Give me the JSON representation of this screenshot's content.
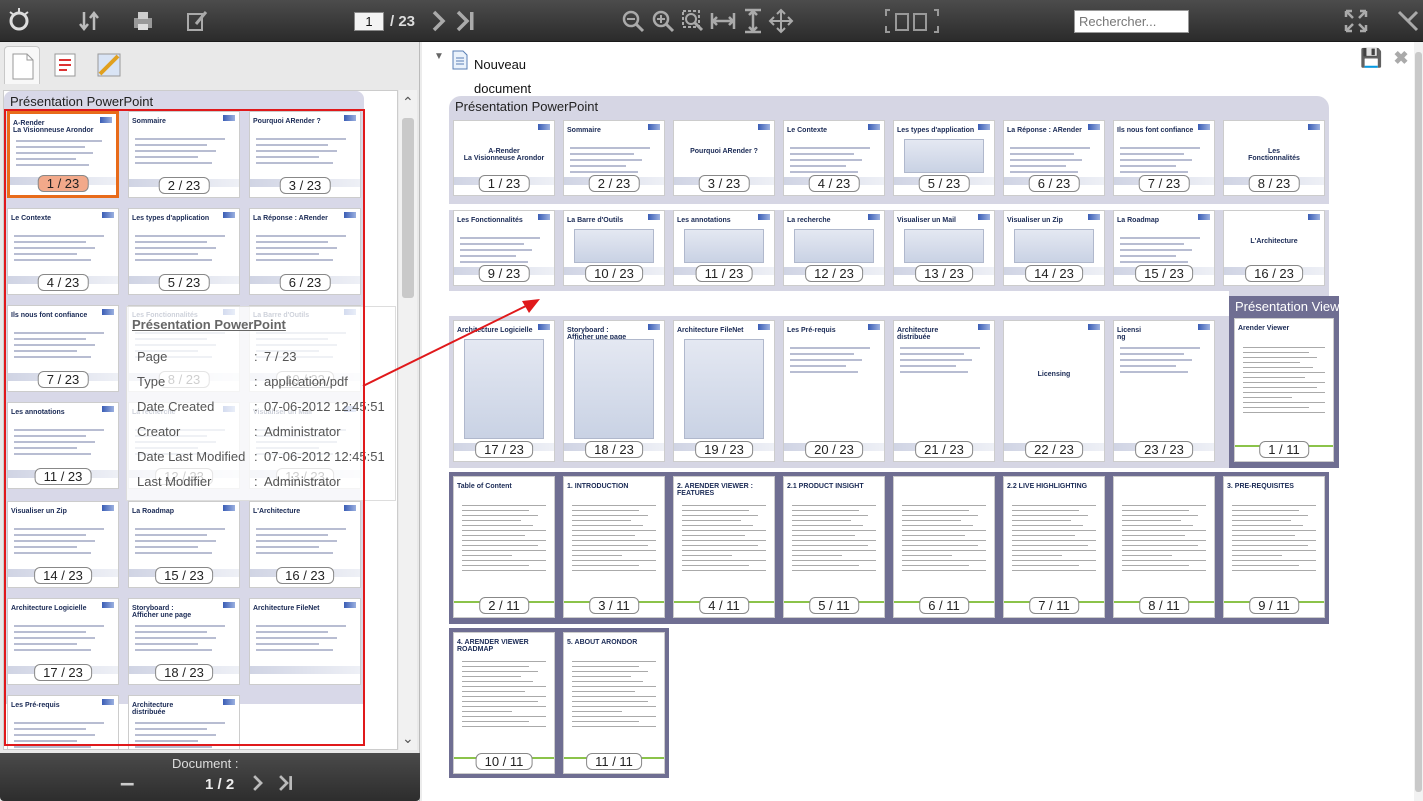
{
  "toolbar": {
    "current_page": "1",
    "total_pages": "/ 23",
    "search_placeholder": "Rechercher..."
  },
  "left_panel": {
    "group_title": "Présentation PowerPoint",
    "thumbnails": [
      {
        "label": "1 / 23",
        "title": "A-Render\nLa Visionneuse Arondor",
        "selected": true
      },
      {
        "label": "2 / 23",
        "title": "Sommaire"
      },
      {
        "label": "3 / 23",
        "title": "Pourquoi ARender ?"
      },
      {
        "label": "4 / 23",
        "title": "Le Contexte"
      },
      {
        "label": "5 / 23",
        "title": "Les types d'application"
      },
      {
        "label": "6 / 23",
        "title": "La Réponse : ARender"
      },
      {
        "label": "7 / 23",
        "title": "Ils nous font confiance"
      },
      {
        "label": "8 / 23",
        "title": "Les Fonctionnalités"
      },
      {
        "label": "10 / 23",
        "title": "La Barre d'Outils"
      },
      {
        "label": "11 / 23",
        "title": "Les annotations"
      },
      {
        "label": "12 / 23",
        "title": "La recherche"
      },
      {
        "label": "13 / 23",
        "title": "Visualiser un Mail"
      },
      {
        "label": "14 / 23",
        "title": "Visualiser un Zip"
      },
      {
        "label": "15 / 23",
        "title": "La Roadmap"
      },
      {
        "label": "16 / 23",
        "title": "L'Architecture"
      },
      {
        "label": "17 / 23",
        "title": "Architecture Logicielle"
      },
      {
        "label": "18 / 23",
        "title": "Storyboard :\nAfficher une page"
      },
      {
        "label": "",
        "title": "Architecture FileNet"
      },
      {
        "label": "",
        "title": "Les Pré-requis"
      },
      {
        "label": "",
        "title": "Architecture\ndistribuée"
      }
    ],
    "tooltip": {
      "title": "Présentation PowerPoint",
      "rows": [
        {
          "key": "Page",
          "value": "7 / 23"
        },
        {
          "key": "Type",
          "value": "application/pdf"
        },
        {
          "key": "Date Created",
          "value": "07-06-2012 12:45:51"
        },
        {
          "key": "Creator",
          "value": "Administrator"
        },
        {
          "key": "Date Last Modified",
          "value": "07-06-2012 12:45:51"
        },
        {
          "key": "Last Modifier",
          "value": "Administrator"
        }
      ]
    },
    "bottom_nav": {
      "label": "Document :",
      "page": "1 / 2"
    }
  },
  "right_panel": {
    "document_title": "Nouveau document",
    "group1_title": "Présentation PowerPoint",
    "group2_title": "Présentation Viewer",
    "row1": [
      {
        "label": "1 / 23",
        "title": "A-Render\nLa Visionneuse Arondor",
        "center": true
      },
      {
        "label": "2 / 23",
        "title": "Sommaire"
      },
      {
        "label": "3 / 23",
        "title": "Pourquoi ARender ?",
        "center": true
      },
      {
        "label": "4 / 23",
        "title": "Le Contexte"
      },
      {
        "label": "5 / 23",
        "title": "Les types d'application",
        "pic": true
      },
      {
        "label": "6 / 23",
        "title": "La Réponse : ARender"
      },
      {
        "label": "7 / 23",
        "title": "Ils nous font confiance"
      },
      {
        "label": "8 / 23",
        "title": "Les\nFonctionnalités",
        "center": true
      }
    ],
    "row2": [
      {
        "label": "9 / 23",
        "title": "Les Fonctionnalités"
      },
      {
        "label": "10 / 23",
        "title": "La Barre d'Outils",
        "pic": true
      },
      {
        "label": "11 / 23",
        "title": "Les annotations",
        "pic": true
      },
      {
        "label": "12 / 23",
        "title": "La recherche",
        "pic": true
      },
      {
        "label": "13 / 23",
        "title": "Visualiser un Mail",
        "pic": true
      },
      {
        "label": "14 / 23",
        "title": "Visualiser un Zip",
        "pic": true
      },
      {
        "label": "15 / 23",
        "title": "La Roadmap"
      },
      {
        "label": "16 / 23",
        "title": "L'Architecture",
        "center": true
      }
    ],
    "row3": [
      {
        "label": "17 / 23",
        "title": "Architecture Logicielle",
        "pic": true
      },
      {
        "label": "18 / 23",
        "title": "Storyboard :\nAfficher une page",
        "pic": true
      },
      {
        "label": "19 / 23",
        "title": "Architecture FileNet",
        "pic": true
      },
      {
        "label": "20 / 23",
        "title": "Les Pré-requis"
      },
      {
        "label": "21 / 23",
        "title": "Architecture\ndistribuée"
      },
      {
        "label": "22 / 23",
        "title": "Licensing",
        "center": true
      },
      {
        "label": "23 / 23",
        "title": "Licensi\nng"
      }
    ],
    "viewer_first": {
      "label": "1 / 11",
      "title": "Arender Viewer"
    },
    "row4": [
      {
        "label": "2 / 11",
        "title": "Table of Content"
      },
      {
        "label": "3 / 11",
        "title": "1. INTRODUCTION"
      },
      {
        "label": "4 / 11",
        "title": "2. ARENDER VIEWER : FEATURES"
      },
      {
        "label": "5 / 11",
        "title": "2.1 PRODUCT INSIGHT"
      },
      {
        "label": "6 / 11",
        "title": ""
      },
      {
        "label": "7 / 11",
        "title": "2.2 LIVE HIGHLIGHTING"
      },
      {
        "label": "8 / 11",
        "title": ""
      },
      {
        "label": "9 / 11",
        "title": "3. PRE-REQUISITES"
      }
    ],
    "row5": [
      {
        "label": "10 / 11",
        "title": "4. ARENDER VIEWER ROADMAP"
      },
      {
        "label": "11 / 11",
        "title": "5. ABOUT ARONDOR"
      }
    ]
  }
}
